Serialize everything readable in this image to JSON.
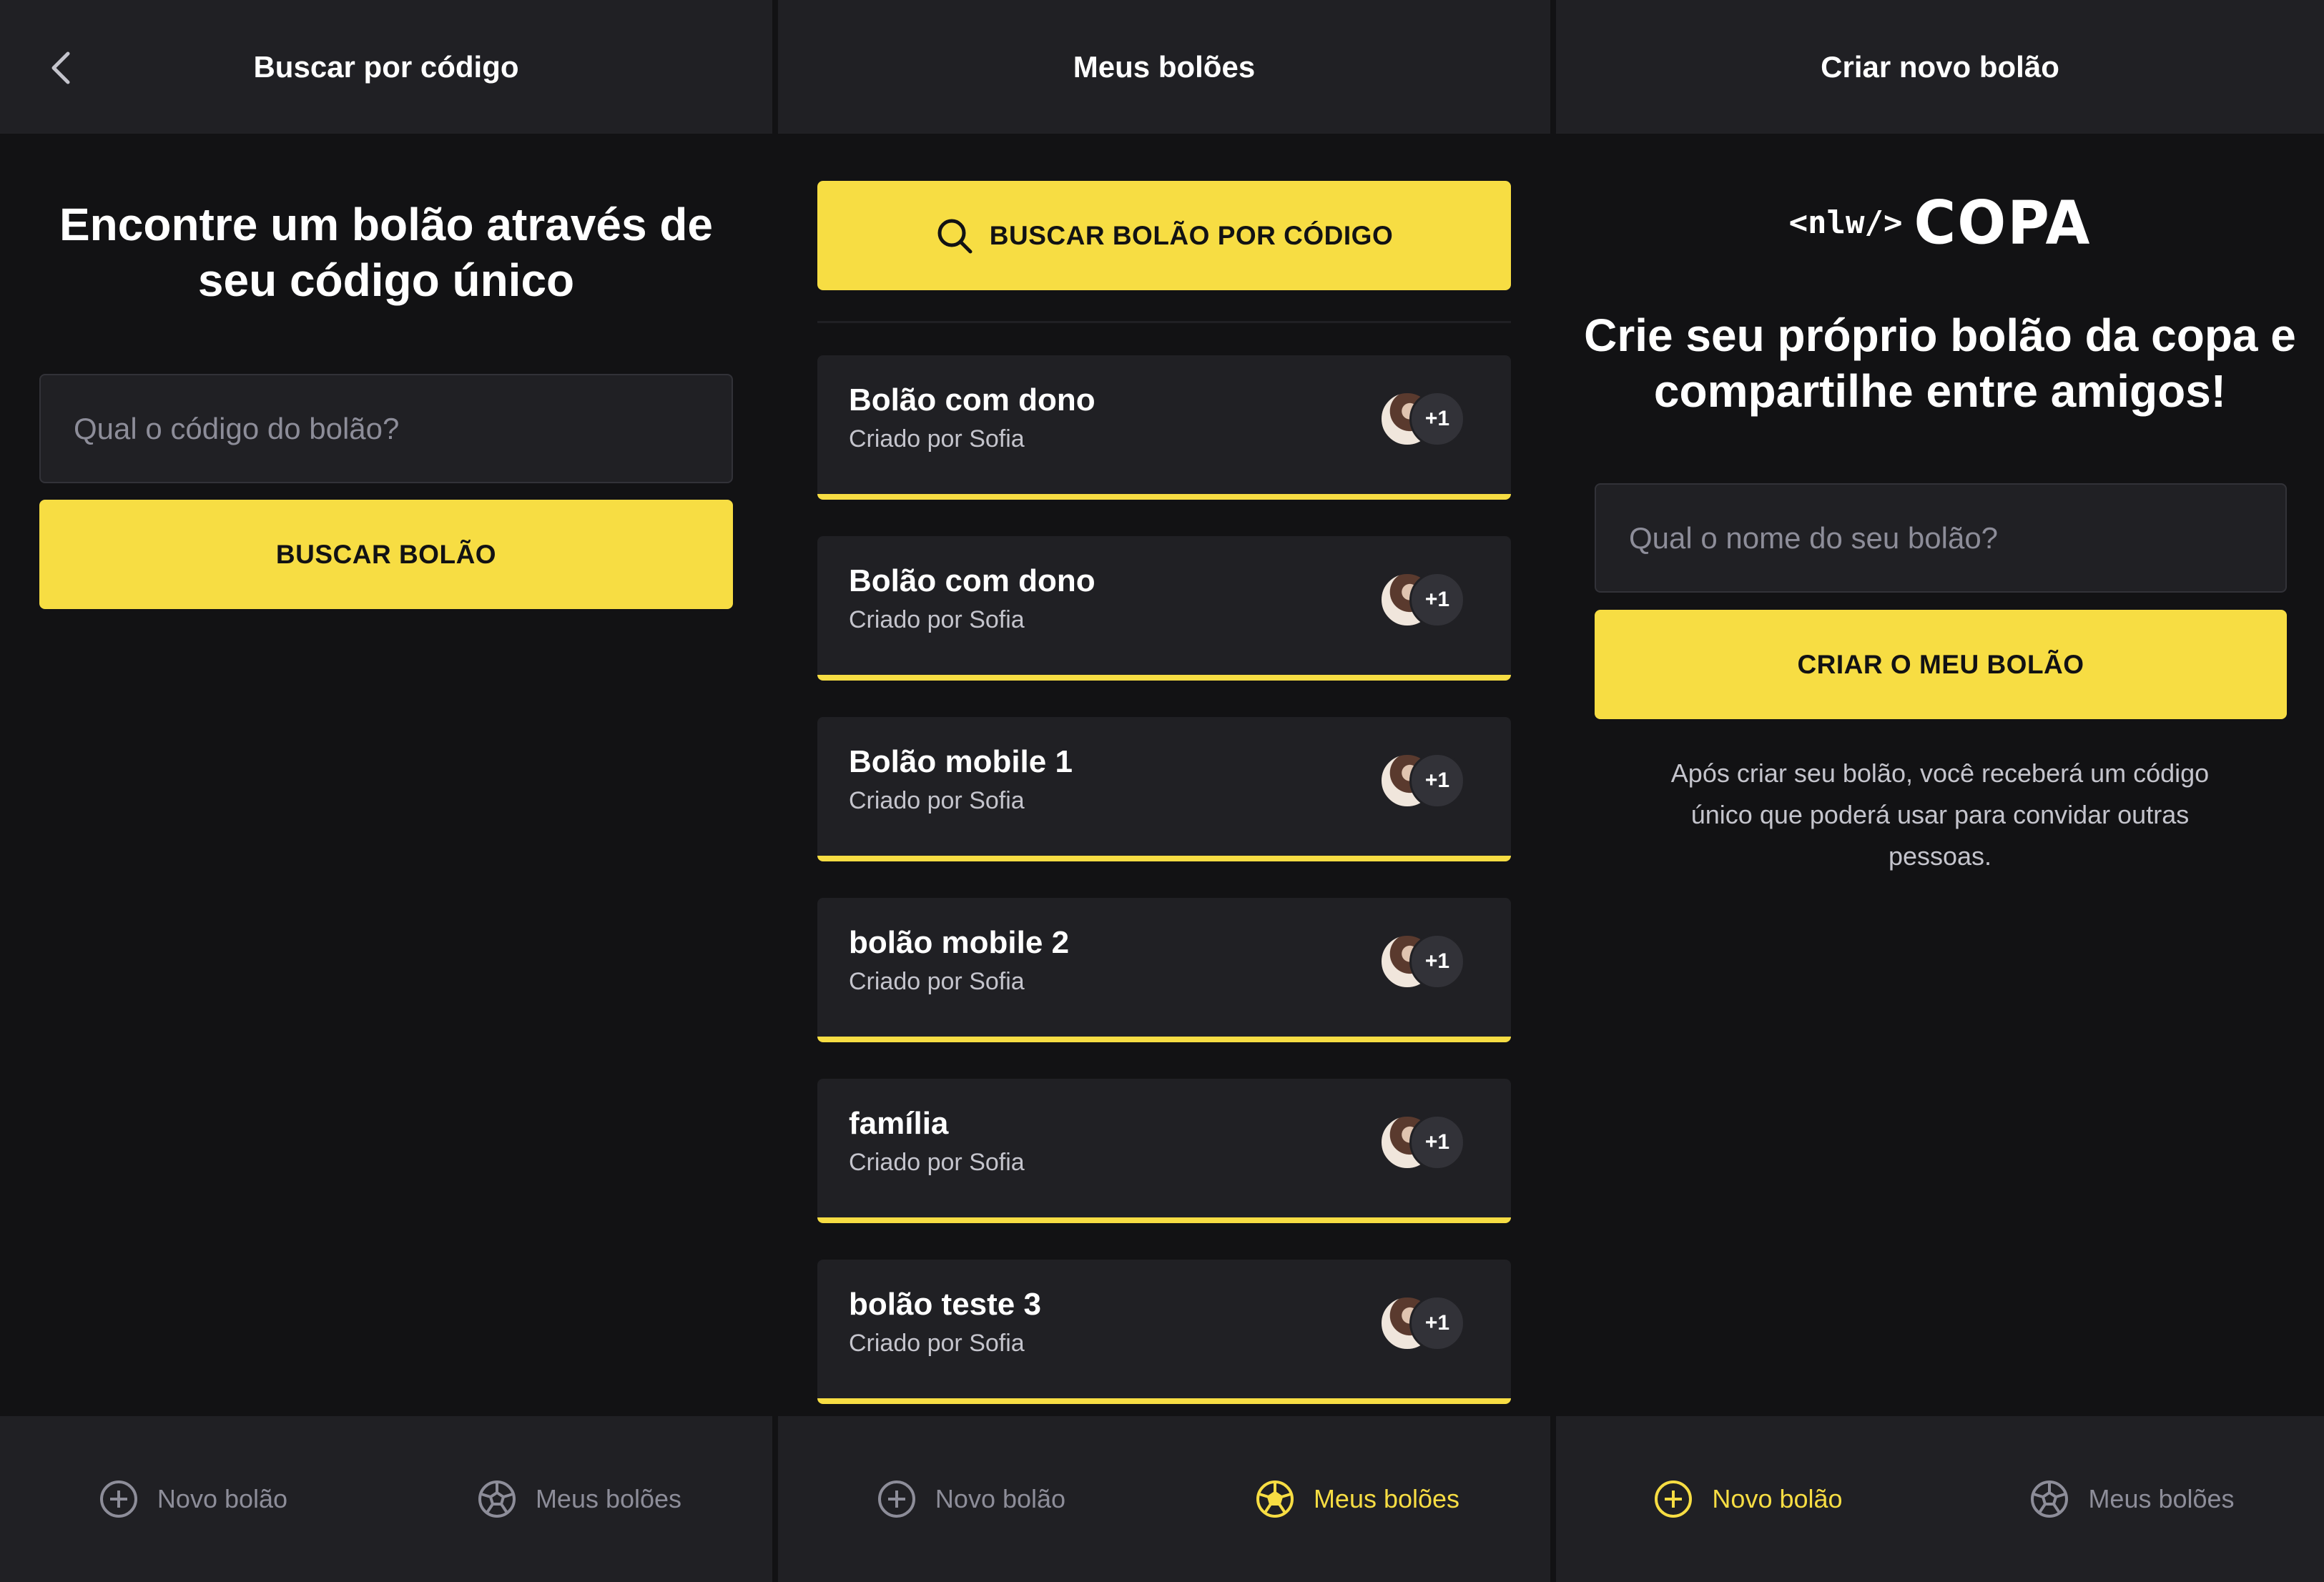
{
  "search_screen": {
    "header_title": "Buscar por código",
    "heading": "Encontre um bolão através de seu código único",
    "input_placeholder": "Qual o código do bolão?",
    "button_label": "BUSCAR BOLÃO"
  },
  "list_screen": {
    "header_title": "Meus bolões",
    "search_button_label": "BUSCAR BOLÃO POR CÓDIGO",
    "pools": [
      {
        "name": "Bolão com dono",
        "owner": "Criado por Sofia",
        "extra": "+1"
      },
      {
        "name": "Bolão com dono",
        "owner": "Criado por Sofia",
        "extra": "+1"
      },
      {
        "name": "Bolão mobile 1",
        "owner": "Criado por Sofia",
        "extra": "+1"
      },
      {
        "name": "bolão mobile 2",
        "owner": "Criado por Sofia",
        "extra": "+1"
      },
      {
        "name": "família",
        "owner": "Criado por Sofia",
        "extra": "+1"
      },
      {
        "name": "bolão teste 3",
        "owner": "Criado por Sofia",
        "extra": "+1"
      }
    ]
  },
  "create_screen": {
    "header_title": "Criar novo bolão",
    "logo_tag": "<nlw/>",
    "logo_word": "COPA",
    "heading": "Crie seu próprio bolão da copa e compartilhe entre amigos!",
    "input_placeholder": "Qual o nome do seu bolão?",
    "button_label": "CRIAR O MEU BOLÃO",
    "note": "Após criar seu bolão, você receberá um código único que poderá usar para convidar outras pessoas."
  },
  "tabs": {
    "new_label": "Novo bolão",
    "mine_label": "Meus bolões"
  },
  "colors": {
    "accent": "#f7dd43",
    "background": "#121214",
    "surface": "#202024",
    "muted_text": "#8d8d99"
  },
  "icons": [
    "chevron-left-icon",
    "search-icon",
    "plus-circle-icon",
    "soccer-ball-icon"
  ]
}
